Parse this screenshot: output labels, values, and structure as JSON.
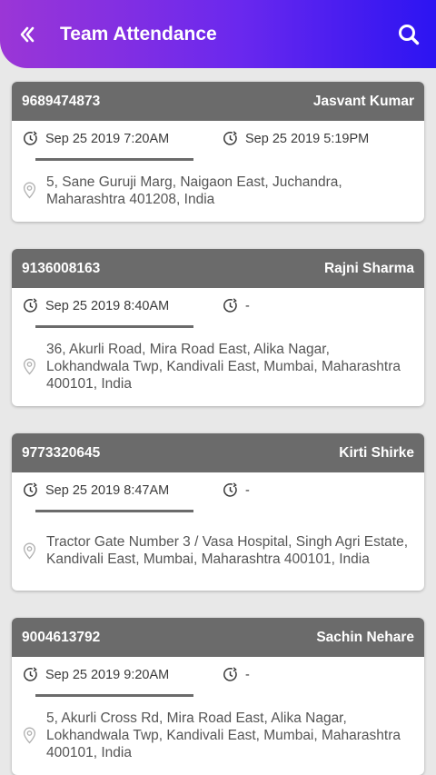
{
  "header": {
    "title": "Team Attendance"
  },
  "records": [
    {
      "phone": "9689474873",
      "name": "Jasvant Kumar",
      "check_in": "Sep 25 2019  7:20AM",
      "check_out": "Sep 25 2019  5:19PM",
      "address": "5, Sane Guruji Marg, Naigaon East, Juchandra, Maharashtra 401208, India"
    },
    {
      "phone": "9136008163",
      "name": "Rajni Sharma",
      "check_in": "Sep 25 2019  8:40AM",
      "check_out": "-",
      "address": "36, Akurli Road, Mira Road East, Alika Nagar, Lokhandwala Twp, Kandivali East, Mumbai, Maharashtra 400101, India"
    },
    {
      "phone": "9773320645",
      "name": "Kirti Shirke",
      "check_in": "Sep 25 2019  8:47AM",
      "check_out": "-",
      "address": "Tractor Gate Number 3 / Vasa Hospital, Singh Agri Estate, Kandivali East, Mumbai, Maharashtra 400101, India"
    },
    {
      "phone": "9004613792",
      "name": "Sachin Nehare",
      "check_in": "Sep 25 2019  9:20AM",
      "check_out": "-",
      "address": "5, Akurli Cross Rd, Mira Road East, Alika Nagar, Lokhandwala Twp, Kandivali East, Mumbai, Maharashtra 400101, India"
    }
  ]
}
